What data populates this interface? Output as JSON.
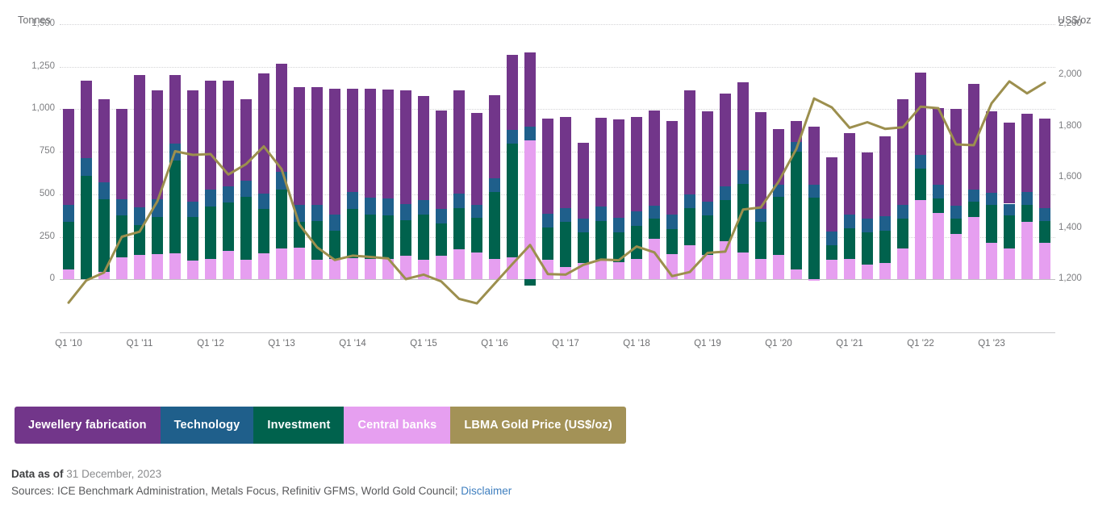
{
  "chart_data": {
    "type": "bar",
    "title": "",
    "subtitle": "",
    "xlabel": "",
    "ylabel": "Tonnes",
    "y2label": "US$/oz",
    "ylim": [
      -150,
      1500
    ],
    "y2lim": [
      1100,
      2200
    ],
    "yticks": [
      "0",
      "250",
      "500",
      "750",
      "1,000",
      "1,250",
      "1,500"
    ],
    "ytick_values": [
      0,
      250,
      500,
      750,
      1000,
      1250,
      1500
    ],
    "y2ticks": [
      "1,200",
      "1,400",
      "1,600",
      "1,800",
      "2,000",
      "2,200"
    ],
    "y2tick_values": [
      1200,
      1400,
      1600,
      1800,
      2000,
      2200
    ],
    "grid": true,
    "legend_position": "bottom-left",
    "xtick_labels": [
      "Q1 '10",
      "Q1 '11",
      "Q1 '12",
      "Q1 '13",
      "Q1 '14",
      "Q1 '15",
      "Q1 '16",
      "Q1 '17",
      "Q1 '18",
      "Q1 '19",
      "Q1 '20",
      "Q1 '21",
      "Q1 '22",
      "Q1 '23"
    ],
    "xtick_indices": [
      0,
      4,
      8,
      12,
      16,
      20,
      24,
      28,
      32,
      36,
      40,
      44,
      48,
      52
    ],
    "x": [
      "Q1 '10",
      "Q2 '10",
      "Q3 '10",
      "Q4 '10",
      "Q1 '11",
      "Q2 '11",
      "Q3 '11",
      "Q4 '11",
      "Q1 '12",
      "Q2 '12",
      "Q3 '12",
      "Q4 '12",
      "Q1 '13",
      "Q2 '13",
      "Q3 '13",
      "Q4 '13",
      "Q1 '14",
      "Q2 '14",
      "Q3 '14",
      "Q4 '14",
      "Q1 '15",
      "Q2 '15",
      "Q3 '15",
      "Q4 '15",
      "Q1 '16",
      "Q2 '16",
      "Q3 '16",
      "Q4 '16",
      "Q1 '17",
      "Q2 '17",
      "Q3 '17",
      "Q4 '17",
      "Q1 '18",
      "Q2 '18",
      "Q3 '18",
      "Q4 '18",
      "Q1 '19",
      "Q2 '19",
      "Q3 '19",
      "Q4 '19",
      "Q1 '20",
      "Q2 '20",
      "Q3 '20",
      "Q4 '20",
      "Q1 '21",
      "Q2 '21",
      "Q3 '21",
      "Q4 '21",
      "Q1 '22",
      "Q2 '22",
      "Q3 '22",
      "Q4 '22",
      "Q1 '23",
      "Q2 '23",
      "Q3 '23",
      "Q4 '23"
    ],
    "series": [
      {
        "name": "Central banks",
        "color": "#e69ff0",
        "values": [
          60,
          0,
          45,
          130,
          145,
          150,
          155,
          110,
          120,
          170,
          115,
          155,
          180,
          185,
          115,
          120,
          125,
          120,
          120,
          140,
          115,
          140,
          175,
          160,
          120,
          130,
          815,
          115,
          75,
          95,
          115,
          100,
          120,
          240,
          150,
          200,
          145,
          225,
          160,
          120,
          145,
          60,
          -10,
          115,
          120,
          85,
          95,
          180,
          465,
          390,
          265,
          365,
          215,
          180,
          340,
          215
        ]
      },
      {
        "name": "Investment",
        "color": "#00624d",
        "values": [
          280,
          610,
          425,
          245,
          175,
          215,
          545,
          255,
          310,
          280,
          370,
          260,
          350,
          155,
          230,
          165,
          290,
          260,
          255,
          210,
          265,
          190,
          245,
          200,
          395,
          670,
          -35,
          190,
          265,
          180,
          230,
          175,
          195,
          115,
          145,
          220,
          230,
          240,
          400,
          220,
          340,
          690,
          480,
          85,
          180,
          190,
          190,
          175,
          185,
          85,
          90,
          90,
          225,
          195,
          100,
          130
        ]
      },
      {
        "name": "Technology",
        "color": "#1f5f8b",
        "values": [
          100,
          105,
          100,
          95,
          105,
          105,
          100,
          90,
          100,
          95,
          95,
          90,
          100,
          100,
          95,
          95,
          100,
          100,
          100,
          95,
          85,
          85,
          85,
          80,
          80,
          80,
          85,
          80,
          80,
          80,
          85,
          85,
          85,
          80,
          85,
          80,
          80,
          80,
          80,
          75,
          70,
          60,
          75,
          80,
          80,
          80,
          85,
          85,
          80,
          80,
          80,
          75,
          70,
          70,
          75,
          75
        ]
      },
      {
        "name": "Jewellery fabrication",
        "color": "#72368a",
        "values": [
          560,
          455,
          490,
          530,
          775,
          640,
          400,
          655,
          640,
          625,
          480,
          705,
          640,
          690,
          690,
          740,
          605,
          640,
          640,
          665,
          615,
          580,
          605,
          540,
          490,
          440,
          435,
          560,
          535,
          450,
          520,
          580,
          555,
          560,
          550,
          610,
          535,
          545,
          520,
          570,
          330,
          120,
          345,
          440,
          480,
          390,
          470,
          620,
          485,
          450,
          565,
          620,
          480,
          475,
          460,
          525
        ]
      }
    ],
    "line_series": {
      "name": "LBMA Gold Price (US$/oz)",
      "color": "#9c8f4e",
      "axis": "right",
      "values": [
        1109,
        1196,
        1227,
        1367,
        1387,
        1506,
        1702,
        1688,
        1691,
        1611,
        1652,
        1721,
        1632,
        1415,
        1326,
        1276,
        1293,
        1288,
        1282,
        1201,
        1219,
        1192,
        1124,
        1106,
        1183,
        1260,
        1335,
        1221,
        1219,
        1257,
        1278,
        1275,
        1329,
        1306,
        1213,
        1229,
        1304,
        1309,
        1474,
        1482,
        1583,
        1711,
        1909,
        1874,
        1794,
        1816,
        1790,
        1796,
        1877,
        1871,
        1729,
        1726,
        1890,
        1976,
        1929,
        1971
      ]
    }
  },
  "legend": {
    "items": [
      {
        "label": "Jewellery fabrication",
        "color": "#72368a",
        "text_color": "#ffffff"
      },
      {
        "label": "Technology",
        "color": "#1f5f8b",
        "text_color": "#ffffff"
      },
      {
        "label": "Investment",
        "color": "#00624d",
        "text_color": "#ffffff"
      },
      {
        "label": "Central banks",
        "color": "#e69ff0",
        "text_color": "#ffffff"
      },
      {
        "label": "LBMA Gold Price (US$/oz)",
        "color": "#a39257",
        "text_color": "#ffffff"
      }
    ]
  },
  "footer": {
    "data_as_of_label": "Data as of",
    "data_as_of_value": "31 December, 2023",
    "sources_text": "Sources: ICE Benchmark Administration, Metals Focus, Refinitiv GFMS, World Gold Council;",
    "disclaimer_link": "Disclaimer"
  }
}
